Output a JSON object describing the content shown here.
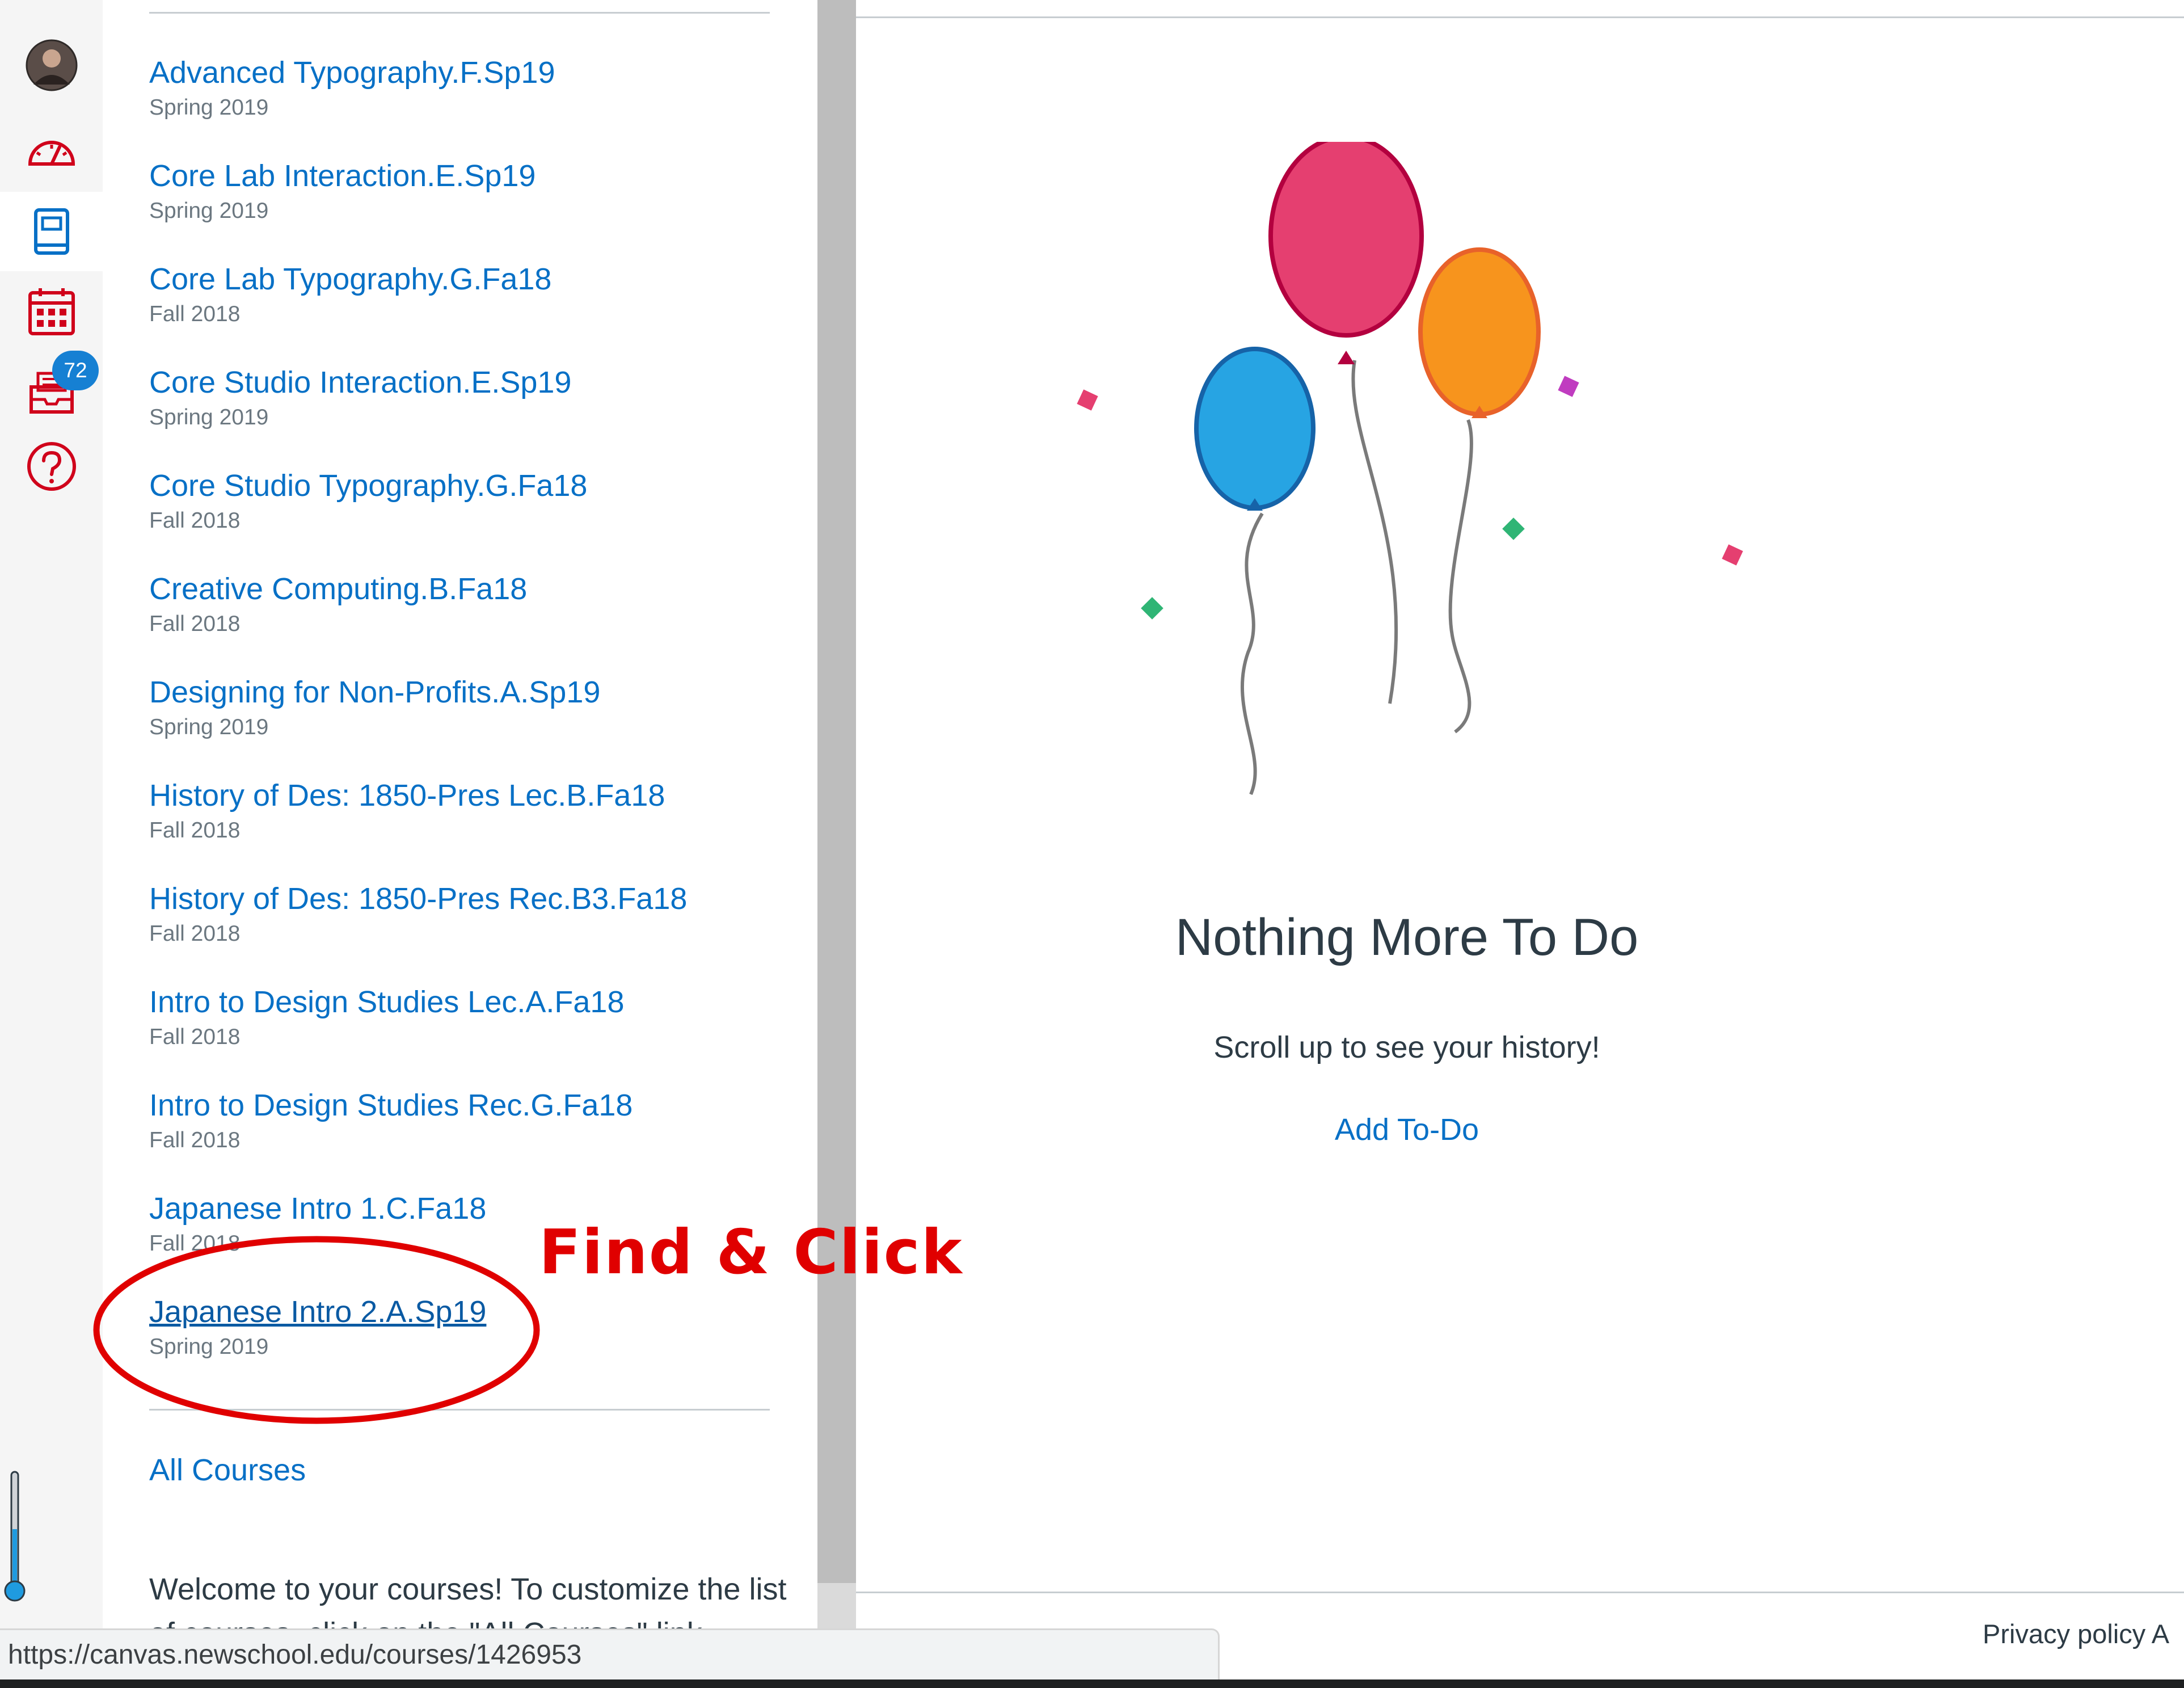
{
  "nav": {
    "badge_count": "72",
    "items": [
      "account",
      "dashboard",
      "courses",
      "calendar",
      "inbox",
      "help"
    ]
  },
  "tray": {
    "courses": [
      {
        "name": "Advanced Typography.F.Sp19",
        "term": "Spring 2019"
      },
      {
        "name": "Core Lab Interaction.E.Sp19",
        "term": "Spring 2019"
      },
      {
        "name": "Core Lab Typography.G.Fa18",
        "term": "Fall 2018"
      },
      {
        "name": "Core Studio Interaction.E.Sp19",
        "term": "Spring 2019"
      },
      {
        "name": "Core Studio Typography.G.Fa18",
        "term": "Fall 2018"
      },
      {
        "name": "Creative Computing.B.Fa18",
        "term": "Fall 2018"
      },
      {
        "name": "Designing for Non-Profits.A.Sp19",
        "term": "Spring 2019"
      },
      {
        "name": "History of Des: 1850-Pres Lec.B.Fa18",
        "term": "Fall 2018"
      },
      {
        "name": "History of Des: 1850-Pres Rec.B3.Fa18",
        "term": "Fall 2018"
      },
      {
        "name": "Intro to Design Studies Lec.A.Fa18",
        "term": "Fall 2018"
      },
      {
        "name": "Intro to Design Studies Rec.G.Fa18",
        "term": "Fall 2018"
      },
      {
        "name": "Japanese Intro 1.C.Fa18",
        "term": "Fall 2018"
      },
      {
        "name": "Japanese Intro 2.A.Sp19",
        "term": "Spring 2019"
      }
    ],
    "all_courses": "All Courses",
    "welcome": "Welcome to your courses! To customize the list of courses, click on the \"All Courses\" link"
  },
  "main": {
    "title": "Nothing More To Do",
    "message": "Scroll up to see your history!",
    "add_todo": "Add To-Do",
    "footer": "Privacy policy  A"
  },
  "annotation": {
    "label": "Find & Click",
    "color": "#e00000"
  },
  "status_url": "https://canvas.newschool.edu/courses/1426953",
  "colors": {
    "link": "#0770c6",
    "nav_icon": "#d0021b",
    "nav_active": "#0770c6",
    "badge": "#1680d3"
  }
}
